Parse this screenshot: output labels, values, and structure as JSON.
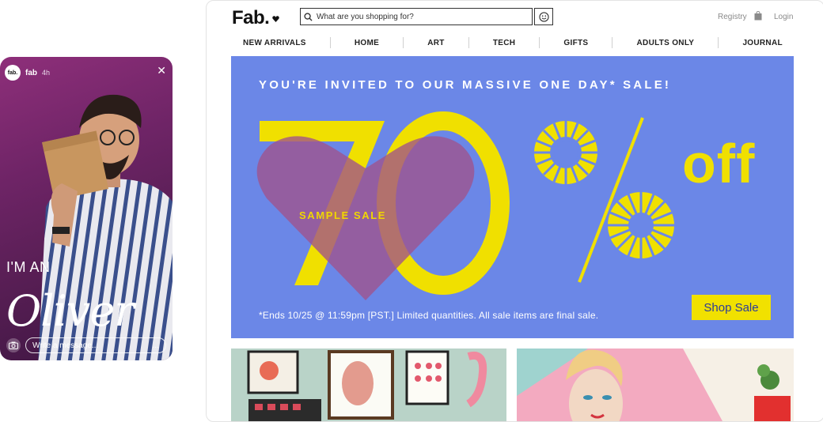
{
  "story": {
    "username": "fab",
    "avatar_text": "fab.",
    "time_ago": "4h",
    "caption_line1": "I'M AN",
    "caption_script": "Oliver",
    "message_placeholder": "Write a message...",
    "more": "..."
  },
  "site": {
    "logo": "Fab.",
    "search_placeholder": "What are you shopping for?",
    "registry": "Registry",
    "login": "Login",
    "nav": [
      "NEW ARRIVALS",
      "HOME",
      "ART",
      "TECH",
      "GIFTS",
      "ADULTS ONLY",
      "JOURNAL"
    ]
  },
  "hero": {
    "title": "YOU'RE INVITED TO OUR MASSIVE ONE DAY* SALE!",
    "big_number": "70",
    "percent": "%",
    "off": "off",
    "badge": "SAMPLE SALE",
    "footnote": "*Ends 10/25 @ 11:59pm [PST.] Limited quantities. All sale items are final sale.",
    "cta": "Shop Sale",
    "colors": {
      "background": "#6b87e7",
      "accent": "#f0e000",
      "heart": "#a85a8a"
    }
  }
}
